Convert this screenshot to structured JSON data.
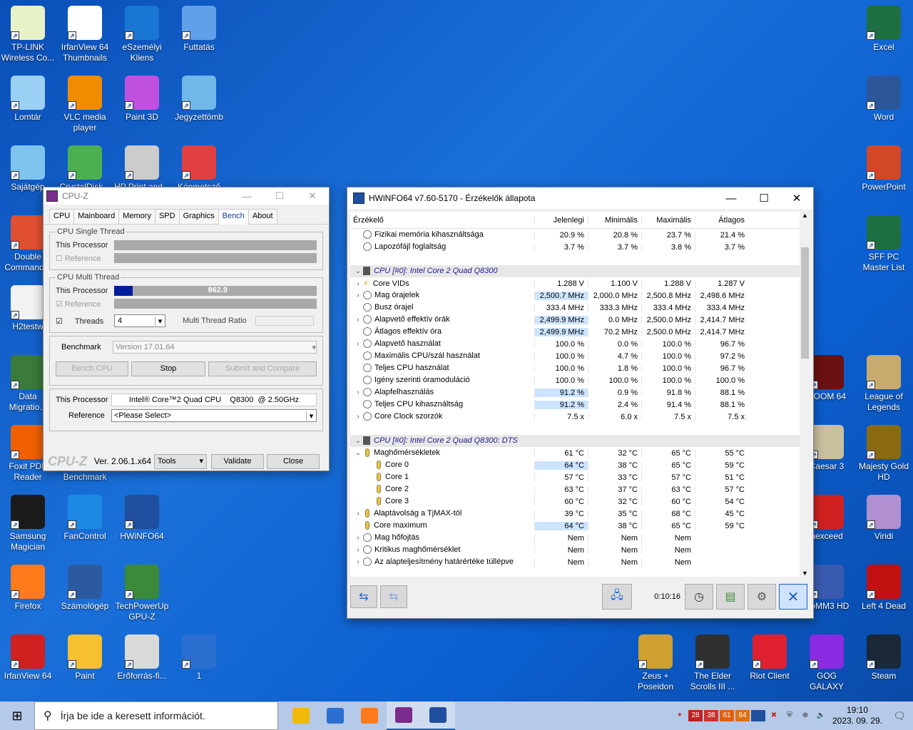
{
  "desktop_icons_left": [
    {
      "label": "TP-LINK Wireless Co...",
      "color": "#e8f2c8"
    },
    {
      "label": "IrfanView 64 Thumbnails",
      "color": "#ffffff"
    },
    {
      "label": "eSzemélyi Kliens",
      "color": "#1976d2"
    },
    {
      "label": "Futtatás",
      "color": "#5fa0e8"
    },
    {
      "label": "Lomtár",
      "color": "#9bd0f5"
    },
    {
      "label": "VLC media player",
      "color": "#f08c00"
    },
    {
      "label": "Paint 3D",
      "color": "#c050e0"
    },
    {
      "label": "Jegyzettömb",
      "color": "#6fb8e8"
    },
    {
      "label": "Sajátgép",
      "color": "#7fc4ee"
    },
    {
      "label": "CrystalDisk...",
      "color": "#4caf50"
    },
    {
      "label": "HP Print and...",
      "color": "#cccccc"
    },
    {
      "label": "Képmetsző",
      "color": "#e04040"
    },
    {
      "label": "Double Command...",
      "color": "#e05030"
    },
    {
      "label": "H2testw",
      "color": "#f2f2f2"
    },
    {
      "label": "Data Migratio...",
      "color": "#3a7a3a"
    },
    {
      "label": "Foxit PDF Reader",
      "color": "#f06000"
    },
    {
      "label": "CPU-Z Benchmark",
      "color": "#7b2b8c"
    },
    {
      "label": "Samsung Magician",
      "color": "#1a1a1a"
    },
    {
      "label": "FanControl",
      "color": "#1e88e5"
    },
    {
      "label": "HWiNFO64",
      "color": "#1f4f9e"
    },
    {
      "label": "Firefox",
      "color": "#ff7a1a"
    },
    {
      "label": "Számológép",
      "color": "#2c5aa0"
    },
    {
      "label": "TechPowerUp GPU-Z",
      "color": "#3a8a3a"
    },
    {
      "label": "IrfanView 64",
      "color": "#d02020"
    },
    {
      "label": "Paint",
      "color": "#f6c030"
    },
    {
      "label": "Erőforrás-fi...",
      "color": "#d9d9d9"
    },
    {
      "label": "1",
      "color": "#2a6fd0"
    }
  ],
  "desktop_icons_right": [
    {
      "label": "Excel",
      "color": "#1d6f42"
    },
    {
      "label": "Word",
      "color": "#2b579a"
    },
    {
      "label": "PowerPoint",
      "color": "#d24726"
    },
    {
      "label": "SFF PC Master List",
      "color": "#1d6f42"
    },
    {
      "label": "DOOM 64",
      "color": "#6a1010"
    },
    {
      "label": "League of Legends",
      "color": "#c8aa6e"
    },
    {
      "label": "Caesar 3",
      "color": "#c9c0a0"
    },
    {
      "label": "Majesty Gold HD",
      "color": "#8a6a10"
    },
    {
      "label": "nexceed",
      "color": "#d02020"
    },
    {
      "label": "Viridi",
      "color": "#b090d0"
    },
    {
      "label": "HoMM3 HD",
      "color": "#3a5ab0"
    },
    {
      "label": "Left 4 Dead",
      "color": "#c01010"
    },
    {
      "label": "Zeus + Poseidon",
      "color": "#d0a030"
    },
    {
      "label": "The Elder Scrolls III ...",
      "color": "#303030"
    },
    {
      "label": "Riot Client",
      "color": "#e02030"
    },
    {
      "label": "GOG GALAXY",
      "color": "#8a2be2"
    },
    {
      "label": "Steam",
      "color": "#1b2838"
    }
  ],
  "cpuz": {
    "title": "CPU-Z",
    "tabs": [
      "CPU",
      "Mainboard",
      "Memory",
      "SPD",
      "Graphics",
      "Bench",
      "About"
    ],
    "active_tab": "Bench",
    "single_legend": "CPU Single Thread",
    "multi_legend": "CPU Multi Thread",
    "this_processor": "This Processor",
    "reference": "Reference",
    "multi_score": "862.9",
    "multi_score_fraction": 0.09,
    "threads_label": "Threads",
    "threads_value": "4",
    "ratio_label": "Multi Thread Ratio",
    "benchmark_label": "Benchmark",
    "benchmark_version": "Version 17.01.64",
    "btn_bench": "Bench CPU",
    "btn_stop": "Stop",
    "btn_submit": "Submit and Compare",
    "proc_label": "This Processor",
    "proc_value": "Intel® Core™2 Quad CPU    Q8300  @ 2.50GHz",
    "ref_label": "Reference",
    "ref_value": "<Please Select>",
    "brand": "CPU-Z",
    "version": "Ver. 2.06.1.x64",
    "tools": "Tools",
    "validate": "Validate",
    "close": "Close"
  },
  "hwinfo": {
    "title": "HWiNFO64 v7.60-5170 - Érzékelők állapota",
    "columns": [
      "Érzékelő",
      "Jelenlegi",
      "Minimális",
      "Maximális",
      "Átlagos"
    ],
    "rows": [
      {
        "type": "s",
        "icon": "circle",
        "name": "Fizikai memória kihasználtsága",
        "v": [
          "20.9 %",
          "20.8 %",
          "23.7 %",
          "21.4 %"
        ]
      },
      {
        "type": "s",
        "icon": "circle",
        "name": "Lapozófájl foglaltság",
        "v": [
          "3.7 %",
          "3.7 %",
          "3.8 %",
          "3.7 %"
        ]
      },
      {
        "type": "blank"
      },
      {
        "type": "grp",
        "name": "CPU [#0]: Intel Core 2 Quad Q8300"
      },
      {
        "type": "s",
        "exp": ">",
        "icon": "bolt",
        "name": "Core VIDs",
        "v": [
          "1.288 V",
          "1.100 V",
          "1.288 V",
          "1.287 V"
        ]
      },
      {
        "type": "s",
        "exp": ">",
        "icon": "circle",
        "name": "Mag órajelek",
        "v": [
          "2,500.7 MHz",
          "2,000.0 MHz",
          "2,500.8 MHz",
          "2,498.6 MHz"
        ],
        "hl": true
      },
      {
        "type": "s",
        "icon": "circle",
        "name": "Busz órajel",
        "v": [
          "333.4 MHz",
          "333.3 MHz",
          "333.4 MHz",
          "333.4 MHz"
        ]
      },
      {
        "type": "s",
        "exp": ">",
        "icon": "circle",
        "name": "Alapvető effektív órák",
        "v": [
          "2,499.9 MHz",
          "0.0 MHz",
          "2,500.0 MHz",
          "2,414.7 MHz"
        ],
        "hl": true
      },
      {
        "type": "s",
        "icon": "circle",
        "name": "Átlagos effektív óra",
        "v": [
          "2,499.9 MHz",
          "70.2 MHz",
          "2,500.0 MHz",
          "2,414.7 MHz"
        ],
        "hl": true
      },
      {
        "type": "s",
        "exp": ">",
        "icon": "circle",
        "name": "Alapvető használat",
        "v": [
          "100.0 %",
          "0.0 %",
          "100.0 %",
          "96.7 %"
        ]
      },
      {
        "type": "s",
        "icon": "circle",
        "name": "Maximális CPU/szál használat",
        "v": [
          "100.0 %",
          "4.7 %",
          "100.0 %",
          "97.2 %"
        ]
      },
      {
        "type": "s",
        "icon": "circle",
        "name": "Teljes CPU használat",
        "v": [
          "100.0 %",
          "1.8 %",
          "100.0 %",
          "96.7 %"
        ]
      },
      {
        "type": "s",
        "icon": "circle",
        "name": "Igény szerinti óramoduláció",
        "v": [
          "100.0 %",
          "100.0 %",
          "100.0 %",
          "100.0 %"
        ]
      },
      {
        "type": "s",
        "exp": ">",
        "icon": "circle",
        "name": "Alapfelhasználás",
        "v": [
          "91.2 %",
          "0.9 %",
          "91.8 %",
          "88.1 %"
        ],
        "hl": true
      },
      {
        "type": "s",
        "icon": "circle",
        "name": "Teljes CPU kihasználtság",
        "v": [
          "91.2 %",
          "2.4 %",
          "91.4 %",
          "88.1 %"
        ],
        "hl": true
      },
      {
        "type": "s",
        "exp": ">",
        "icon": "circle",
        "name": "Core Clock szorzók",
        "v": [
          "7.5 x",
          "6.0 x",
          "7.5 x",
          "7.5 x"
        ]
      },
      {
        "type": "blank"
      },
      {
        "type": "grp",
        "name": "CPU [#0]: Intel Core 2 Quad Q8300: DTS"
      },
      {
        "type": "s",
        "exp": "v",
        "icon": "therm",
        "name": "Maghőmérsékletek",
        "v": [
          "61 °C",
          "32 °C",
          "65 °C",
          "55 °C"
        ]
      },
      {
        "type": "s",
        "indent": true,
        "icon": "therm",
        "name": "Core 0",
        "v": [
          "64 °C",
          "38 °C",
          "65 °C",
          "59 °C"
        ],
        "hl": true
      },
      {
        "type": "s",
        "indent": true,
        "icon": "therm",
        "name": "Core 1",
        "v": [
          "57 °C",
          "33 °C",
          "57 °C",
          "51 °C"
        ]
      },
      {
        "type": "s",
        "indent": true,
        "icon": "therm",
        "name": "Core 2",
        "v": [
          "63 °C",
          "37 °C",
          "63 °C",
          "57 °C"
        ]
      },
      {
        "type": "s",
        "indent": true,
        "icon": "therm",
        "name": "Core 3",
        "v": [
          "60 °C",
          "32 °C",
          "60 °C",
          "54 °C"
        ]
      },
      {
        "type": "s",
        "exp": ">",
        "icon": "therm",
        "name": "Alaptávolság a TjMAX-tól",
        "v": [
          "39 °C",
          "35 °C",
          "68 °C",
          "45 °C"
        ]
      },
      {
        "type": "s",
        "icon": "therm",
        "name": "Core maximum",
        "v": [
          "64 °C",
          "38 °C",
          "65 °C",
          "59 °C"
        ],
        "hl": true
      },
      {
        "type": "s",
        "exp": ">",
        "icon": "circle",
        "name": "Mag hőfojtás",
        "v": [
          "Nem",
          "Nem",
          "Nem",
          ""
        ]
      },
      {
        "type": "s",
        "exp": ">",
        "icon": "circle",
        "name": "Kritikus maghőmérséklet",
        "v": [
          "Nem",
          "Nem",
          "Nem",
          ""
        ]
      },
      {
        "type": "s",
        "exp": ">",
        "icon": "circle",
        "name": "Az alapteljesítmény határértéke túllépve",
        "v": [
          "Nem",
          "Nem",
          "Nem",
          ""
        ]
      }
    ],
    "timer": "0:10:16"
  },
  "taskbar": {
    "search_placeholder": "Írja be ide a keresett információt.",
    "apps": [
      {
        "name": "file-explorer",
        "color": "#f2b90a"
      },
      {
        "name": "ms-store",
        "color": "#2b6fd0"
      },
      {
        "name": "firefox",
        "color": "#ff7a1a"
      },
      {
        "name": "cpu-z",
        "color": "#7b2b8c"
      },
      {
        "name": "hwinfo",
        "color": "#1f4f9e"
      }
    ],
    "tray_numbers": [
      "28",
      "38",
      "61",
      "64"
    ],
    "time": "19:10",
    "date": "2023. 09. 29."
  }
}
